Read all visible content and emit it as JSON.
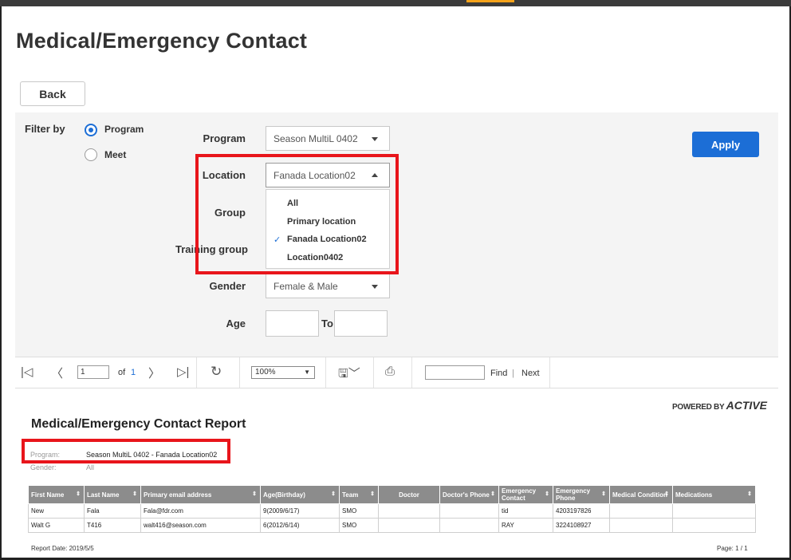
{
  "page": {
    "title": "Medical/Emergency Contact"
  },
  "back_button": {
    "label": "Back"
  },
  "filter": {
    "filter_by_label": "Filter by",
    "options": [
      {
        "label": "Program",
        "checked": true
      },
      {
        "label": "Meet",
        "checked": false
      }
    ],
    "program": {
      "label": "Program",
      "value": "Season MultiL 0402"
    },
    "location": {
      "label": "Location",
      "value": "Fanada Location02",
      "dropdown_items": [
        "All",
        "Primary location",
        "Fanada Location02",
        "Location0402"
      ],
      "selected_item": "Fanada Location02"
    },
    "group": {
      "label": "Group"
    },
    "training_group": {
      "label": "Training group"
    },
    "gender": {
      "label": "Gender",
      "value": "Female & Male"
    },
    "age": {
      "label": "Age",
      "to_label": "To"
    },
    "apply_label": "Apply"
  },
  "toolbar": {
    "page_value": "1",
    "of_label": "of",
    "page_total": "1",
    "zoom": "100%",
    "find_label": "Find",
    "next_label": "Next"
  },
  "report": {
    "powered_by": "POWERED BY",
    "brand": "ACTIVE",
    "title": "Medical/Emergency Contact Report",
    "program_label": "Program:",
    "program_value": "Season MultiL 0402 - Fanada Location02",
    "gender_label": "Gender:",
    "gender_value": "All",
    "columns": [
      "First Name",
      "Last Name",
      "Primary email address",
      "Age(Birthday)",
      "Team",
      "Doctor",
      "Doctor's Phone",
      "Emergency Contact",
      "Emergency Phone",
      "Medical Condition",
      "Medications"
    ],
    "rows": [
      [
        "New",
        "Fala",
        "Fala@fdr.com",
        "9(2009/6/17)",
        "SMO",
        "",
        "",
        "tid",
        "4203197826",
        "",
        ""
      ],
      [
        "Walt G",
        "T416",
        "walt416@season.com",
        "6(2012/6/14)",
        "SMO",
        "",
        "",
        "RAY",
        "3224108927",
        "",
        ""
      ]
    ],
    "report_date": "Report Date: 2019/5/5",
    "page_info": "Page: 1 / 1"
  },
  "colors": {
    "accent_blue": "#1c6ed6",
    "highlight_red": "#e8151b",
    "header_gray": "#8c8c8c"
  }
}
